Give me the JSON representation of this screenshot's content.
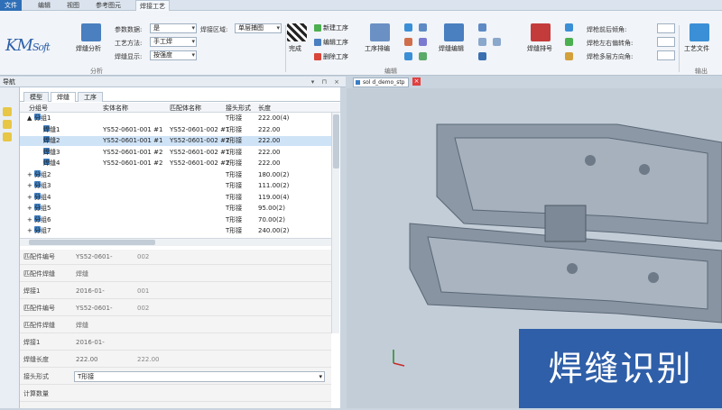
{
  "menu": {
    "tabs": [
      "文件",
      "编辑",
      "视图",
      "参考图元",
      "焊接工艺"
    ],
    "active_tab": "焊接工艺"
  },
  "ribbon": {
    "logo": "KM",
    "logo_suffix": "Soft",
    "weld_analysis": "焊缝分析",
    "params": [
      {
        "label": "参数数据:",
        "value": "是"
      },
      {
        "label": "工艺方法:",
        "value": "手工焊"
      },
      {
        "label": "焊缝显示:",
        "value": "按强度"
      }
    ],
    "weld_area_label": "焊接区域:",
    "weld_area_value": "单层捕图",
    "finish": "完成",
    "process_buttons": [
      "新建工序",
      "编辑工序",
      "删除工序"
    ],
    "process_arrange": "工序排编",
    "weld_edit": "焊缝编辑",
    "weld_compare": "焊缝排号",
    "weld_props": [
      "焊枪前后倾角:",
      "焊枪左右偏转角:",
      "焊枪多层方向角:"
    ],
    "process_doc": "工艺文件",
    "groups": [
      "分析",
      "编辑",
      "输出"
    ]
  },
  "panel": {
    "title": "导航",
    "tabs": [
      "模型",
      "焊缝",
      "工序"
    ],
    "active_tab": "焊缝",
    "columns": [
      "分组号",
      "实体名称",
      "匹配体名称",
      "接头形式",
      "长度"
    ],
    "rows": [
      {
        "indent": 0,
        "expand": "▲",
        "name": "分组1",
        "entity": "",
        "match": "",
        "joint": "T形接",
        "length": "222.00(4)",
        "selected": false
      },
      {
        "indent": 1,
        "expand": "",
        "name": "焊缝1",
        "entity": "YS52-0601-001 #1",
        "match": "YS52-0601-002 #1",
        "joint": "T形接",
        "length": "222.00",
        "selected": false
      },
      {
        "indent": 1,
        "expand": "",
        "name": "焊缝2",
        "entity": "YS52-0601-001 #1",
        "match": "YS52-0601-002 #2",
        "joint": "T形接",
        "length": "222.00",
        "selected": true
      },
      {
        "indent": 1,
        "expand": "",
        "name": "焊缝3",
        "entity": "YS52-0601-001 #2",
        "match": "YS52-0601-002 #1",
        "joint": "T形接",
        "length": "222.00",
        "selected": false
      },
      {
        "indent": 1,
        "expand": "",
        "name": "焊缝4",
        "entity": "YS52-0601-001 #2",
        "match": "YS52-0601-002 #2",
        "joint": "T形接",
        "length": "222.00",
        "selected": false
      },
      {
        "indent": 0,
        "expand": "+",
        "name": "分组2",
        "entity": "",
        "match": "",
        "joint": "T形接",
        "length": "180.00(2)",
        "selected": false
      },
      {
        "indent": 0,
        "expand": "+",
        "name": "分组3",
        "entity": "",
        "match": "",
        "joint": "T形接",
        "length": "111.00(2)",
        "selected": false
      },
      {
        "indent": 0,
        "expand": "+",
        "name": "分组4",
        "entity": "",
        "match": "",
        "joint": "T形接",
        "length": "119.00(4)",
        "selected": false
      },
      {
        "indent": 0,
        "expand": "+",
        "name": "分组5",
        "entity": "",
        "match": "",
        "joint": "T形接",
        "length": "95.00(2)",
        "selected": false
      },
      {
        "indent": 0,
        "expand": "+",
        "name": "分组6",
        "entity": "",
        "match": "",
        "joint": "T形接",
        "length": "70.00(2)",
        "selected": false
      },
      {
        "indent": 0,
        "expand": "+",
        "name": "分组7",
        "entity": "",
        "match": "",
        "joint": "T形接",
        "length": "240.00(2)",
        "selected": false
      }
    ]
  },
  "properties": [
    {
      "key": "匹配件编号",
      "value": "YS52-0601-",
      "value2": "002"
    },
    {
      "key": "匹配件焊缝",
      "value": "焊缝",
      "value2": ""
    },
    {
      "key": "焊接1",
      "value": "2016-01-",
      "value2": "001"
    },
    {
      "key": "匹配件编号",
      "value": "YS52-0601-",
      "value2": "002"
    },
    {
      "key": "匹配件焊缝",
      "value": "焊缝",
      "value2": ""
    },
    {
      "key": "焊接1",
      "value": "2016-01-",
      "value2": ""
    },
    {
      "key": "焊缝长度",
      "value": "222.00",
      "value2": "222.00"
    },
    {
      "key": "接头形式",
      "value": "T形接",
      "value2": "",
      "dropdown": true
    },
    {
      "key": "计算数量",
      "value": "",
      "value2": ""
    }
  ],
  "viewport": {
    "tab_label": "sol d_demo_stp",
    "caption": "焊缝识别"
  }
}
